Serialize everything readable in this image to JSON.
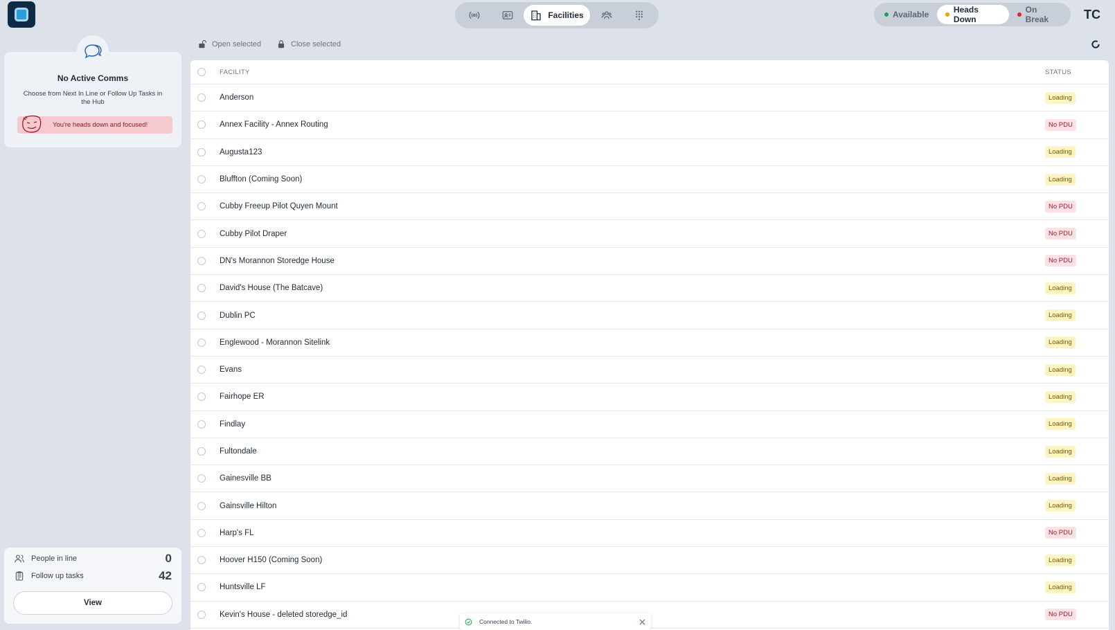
{
  "header": {
    "avatar_initials": "TC",
    "nav": {
      "active_label": "Facilities",
      "icons": [
        "broadcast-icon",
        "contact-card-icon",
        "building-icon",
        "people-group-icon",
        "grid-dots-icon"
      ]
    },
    "status": {
      "available": "Available",
      "heads_down": "Heads Down",
      "on_break": "On Break",
      "colors": {
        "available": "#16a34a",
        "heads_down": "#f59e0b",
        "on_break": "#dc2626"
      }
    }
  },
  "comms": {
    "title": "No Active Comms",
    "description": "Choose from Next In Line or Follow Up Tasks in the Hub",
    "banner": "You're heads down and focused!"
  },
  "stats": {
    "people_label": "People in line",
    "people_count": "0",
    "tasks_label": "Follow up tasks",
    "tasks_count": "42",
    "view_label": "View"
  },
  "actions": {
    "open_label": "Open selected",
    "close_label": "Close selected"
  },
  "table": {
    "col_facility": "FACILITY",
    "col_status": "STATUS",
    "rows": [
      {
        "name": "Anderson",
        "status": "Loading"
      },
      {
        "name": "Annex Facility - Annex Routing",
        "status": "No PDU"
      },
      {
        "name": "Augusta123",
        "status": "Loading"
      },
      {
        "name": "Bluffton (Coming Soon)",
        "status": "Loading"
      },
      {
        "name": "Cubby Freeup Pilot Quyen Mount",
        "status": "No PDU"
      },
      {
        "name": "Cubby Pilot Draper",
        "status": "No PDU"
      },
      {
        "name": "DN's Morannon Storedge House",
        "status": "No PDU"
      },
      {
        "name": "David's House (The Batcave)",
        "status": "Loading"
      },
      {
        "name": "Dublin PC",
        "status": "Loading"
      },
      {
        "name": "Englewood - Morannon Sitelink",
        "status": "Loading"
      },
      {
        "name": "Evans",
        "status": "Loading"
      },
      {
        "name": "Fairhope ER",
        "status": "Loading"
      },
      {
        "name": "Findlay",
        "status": "Loading"
      },
      {
        "name": "Fultondale",
        "status": "Loading"
      },
      {
        "name": "Gainesville BB",
        "status": "Loading"
      },
      {
        "name": "Gainsville Hilton",
        "status": "Loading"
      },
      {
        "name": "Harp's FL",
        "status": "No PDU"
      },
      {
        "name": "Hoover H150 (Coming Soon)",
        "status": "Loading"
      },
      {
        "name": "Huntsville LF",
        "status": "Loading"
      },
      {
        "name": "Kevin's House - deleted storedge_id",
        "status": "No PDU"
      }
    ]
  },
  "toast": {
    "message": "Connected to Twilio."
  }
}
